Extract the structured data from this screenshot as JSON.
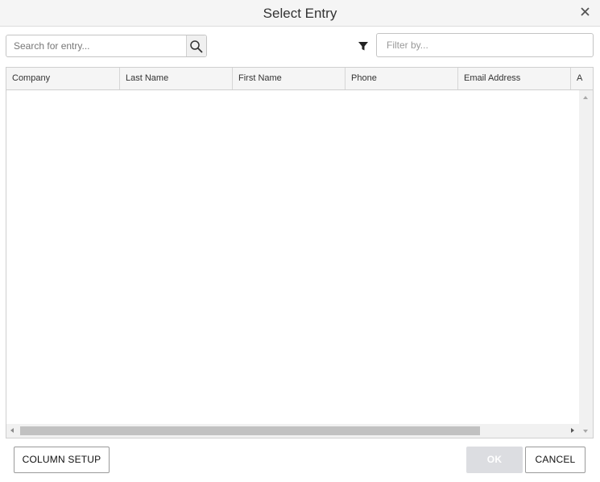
{
  "dialog": {
    "title": "Select Entry"
  },
  "search": {
    "placeholder": "Search for entry...",
    "value": ""
  },
  "filter": {
    "placeholder": "Filter by...",
    "value": ""
  },
  "grid": {
    "columns": [
      "Company",
      "Last Name",
      "First Name",
      "Phone",
      "Email Address",
      "A"
    ],
    "rows": []
  },
  "buttons": {
    "column_setup": "COLUMN SETUP",
    "ok": "OK",
    "cancel": "CANCEL"
  },
  "icons": {
    "close": "close-icon",
    "search": "search-icon",
    "filter": "filter-icon"
  },
  "colors": {
    "title_bar": "#f5f5f5",
    "disabled_button": "#dcdde1",
    "scroll_thumb": "#c1c1c1"
  }
}
